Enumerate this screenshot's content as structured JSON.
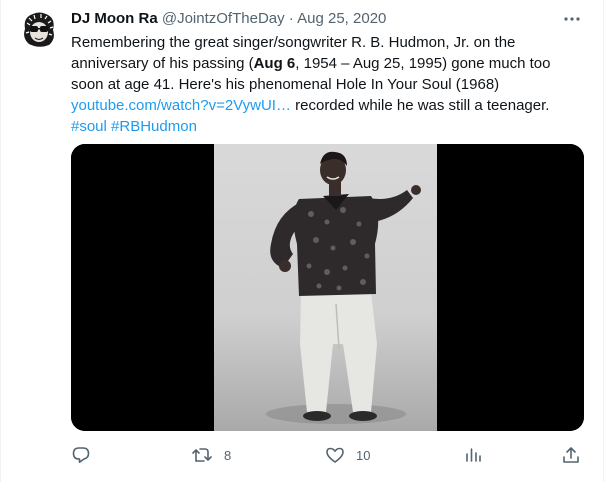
{
  "tweet": {
    "author_name": "DJ Moon Ra",
    "handle": "@JointzOfTheDay",
    "separator": "·",
    "date": "Aug 25, 2020",
    "text_1": "Remembering the great singer/songwriter R. B. Hudmon, Jr. on the anniversary of his passing (",
    "text_bold": "Aug 6",
    "text_2": ", 1954 – Aug 25, 1995) gone much too soon at age 41. Here's his phenomenal Hole In Your Soul (1968) ",
    "link": "youtube.com/watch?v=2VywUI…",
    "text_3": " recorded while he was still a teenager.",
    "hashtag_1": "#soul",
    "hashtag_2": "#RBHudmon",
    "media_icon": "video-still-person-dancing",
    "avatar_icon": "avatar-face-icon",
    "colors": {
      "link": "#1d9bf0",
      "secondary": "#536471",
      "text": "#0f1419"
    }
  },
  "actions": {
    "reply_icon": "reply-icon",
    "retweet_icon": "retweet-icon",
    "retweet_count": "8",
    "like_icon": "heart-icon",
    "like_count": "10",
    "views_icon": "views-icon",
    "share_icon": "share-icon"
  }
}
